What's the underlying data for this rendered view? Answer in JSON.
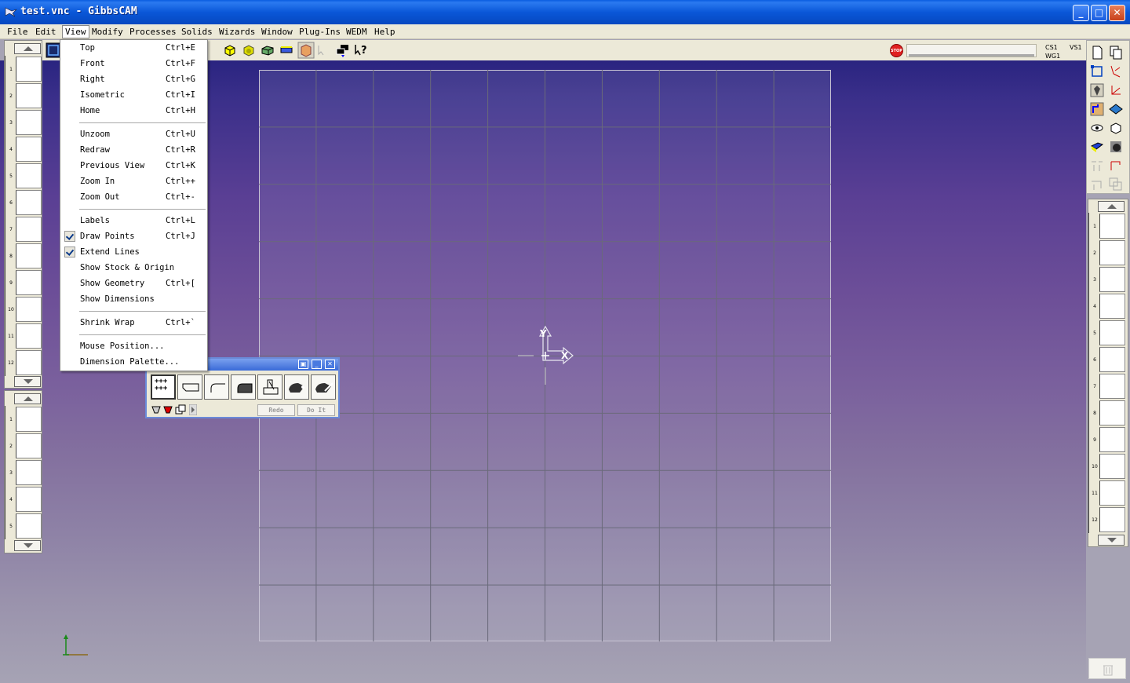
{
  "window": {
    "title": "test.vnc - GibbsCAM",
    "controls": {
      "minimize": "_",
      "maximize": "□",
      "close": "✕"
    }
  },
  "menubar": {
    "items": [
      "File",
      "Edit",
      "View",
      "Modify",
      "Processes",
      "Solids",
      "Wizards",
      "Window",
      "Plug-Ins",
      "WEDM",
      "Help"
    ],
    "active": "View"
  },
  "view_menu": {
    "groups": [
      [
        {
          "label": "Top",
          "shortcut": "Ctrl+E"
        },
        {
          "label": "Front",
          "shortcut": "Ctrl+F"
        },
        {
          "label": "Right",
          "shortcut": "Ctrl+G"
        },
        {
          "label": "Isometric",
          "shortcut": "Ctrl+I"
        },
        {
          "label": "Home",
          "shortcut": "Ctrl+H"
        }
      ],
      [
        {
          "label": "Unzoom",
          "shortcut": "Ctrl+U"
        },
        {
          "label": "Redraw",
          "shortcut": "Ctrl+R"
        },
        {
          "label": "Previous View",
          "shortcut": "Ctrl+K"
        },
        {
          "label": "Zoom In",
          "shortcut": "Ctrl++"
        },
        {
          "label": "Zoom Out",
          "shortcut": "Ctrl+-"
        }
      ],
      [
        {
          "label": "Labels",
          "shortcut": "Ctrl+L"
        },
        {
          "label": "Draw Points",
          "shortcut": "Ctrl+J",
          "checked": true
        },
        {
          "label": "Extend Lines",
          "shortcut": "",
          "checked": true
        },
        {
          "label": "Show Stock & Origin",
          "shortcut": ""
        },
        {
          "label": "Show Geometry",
          "shortcut": "Ctrl+["
        },
        {
          "label": "Show Dimensions",
          "shortcut": ""
        }
      ],
      [
        {
          "label": "Shrink Wrap",
          "shortcut": "Ctrl+`"
        }
      ],
      [
        {
          "label": "Mouse Position...",
          "shortcut": ""
        },
        {
          "label": "Dimension Palette...",
          "shortcut": ""
        }
      ]
    ]
  },
  "status": {
    "cs": "CS1",
    "wg": "WG1",
    "vs": "VS1",
    "stop_label": "STOP"
  },
  "left_tabs_top": [
    "1",
    "2",
    "3",
    "4",
    "5",
    "6",
    "7",
    "8",
    "9",
    "10",
    "11",
    "12"
  ],
  "left_tabs_bottom": [
    "1",
    "2",
    "3",
    "4",
    "5"
  ],
  "right_tabs": [
    "1",
    "2",
    "3",
    "4",
    "5",
    "6",
    "7",
    "8",
    "9",
    "10",
    "11",
    "12"
  ],
  "palette": {
    "redo_label": "Redo",
    "doit_label": "Do It",
    "points_glyph": "+++\n+++"
  },
  "axis": {
    "x_label": "X",
    "y_label": "Y"
  },
  "colors": {
    "titlebar": "#0a57d8",
    "menu_bg": "#ece9d8",
    "viewport_top": "#2a2480",
    "viewport_bottom": "#a6a3b4"
  }
}
